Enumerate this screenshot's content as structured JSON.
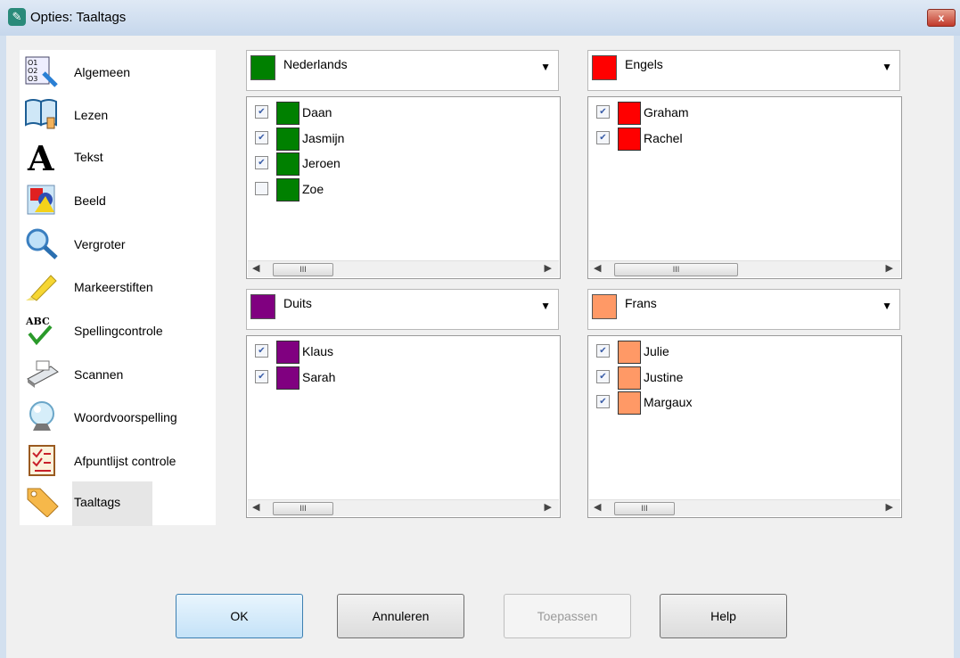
{
  "window": {
    "title": "Opties: Taaltags",
    "close_glyph": "x"
  },
  "sidebar": {
    "items": [
      {
        "label": "Algemeen",
        "icon": "general-options-icon"
      },
      {
        "label": "Lezen",
        "icon": "book-read-icon"
      },
      {
        "label": "Tekst",
        "icon": "text-a-icon"
      },
      {
        "label": "Beeld",
        "icon": "shapes-picture-icon"
      },
      {
        "label": "Vergroter",
        "icon": "magnifier-icon"
      },
      {
        "label": "Markeerstiften",
        "icon": "highlighter-icon"
      },
      {
        "label": "Spellingcontrole",
        "icon": "spellcheck-icon"
      },
      {
        "label": "Scannen",
        "icon": "scanner-icon"
      },
      {
        "label": "Woordvoorspelling",
        "icon": "crystal-ball-icon"
      },
      {
        "label": "Afpuntlijst controle",
        "icon": "checklist-icon"
      },
      {
        "label": "Taaltags",
        "icon": "tag-icon"
      }
    ]
  },
  "languages": [
    {
      "name": "Nederlands",
      "color": "#008000",
      "voices": [
        {
          "name": "Daan",
          "checked": true
        },
        {
          "name": "Jasmijn",
          "checked": true
        },
        {
          "name": "Jeroen",
          "checked": true
        },
        {
          "name": "Zoe",
          "checked": false
        }
      ]
    },
    {
      "name": "Engels",
      "color": "#ff0000",
      "voices": [
        {
          "name": "Graham",
          "checked": true
        },
        {
          "name": "Rachel",
          "checked": true
        }
      ]
    },
    {
      "name": "Duits",
      "color": "#800080",
      "voices": [
        {
          "name": "Klaus",
          "checked": true
        },
        {
          "name": "Sarah",
          "checked": true
        }
      ]
    },
    {
      "name": "Frans",
      "color": "#ff9966",
      "voices": [
        {
          "name": "Julie",
          "checked": true
        },
        {
          "name": "Justine",
          "checked": true
        },
        {
          "name": "Margaux",
          "checked": true
        }
      ]
    }
  ],
  "scroll_thumb_text": "III",
  "buttons": {
    "ok": "OK",
    "cancel": "Annuleren",
    "apply": "Toepassen",
    "help": "Help"
  }
}
